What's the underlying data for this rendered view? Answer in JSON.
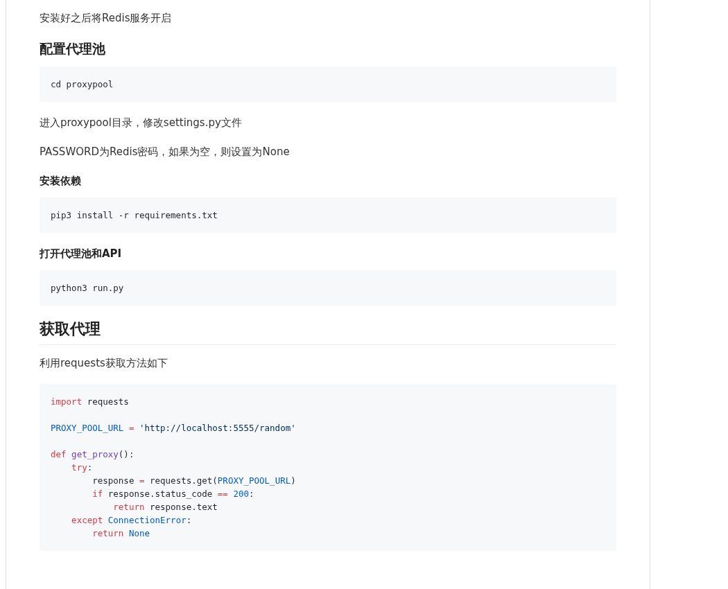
{
  "blocks": [
    {
      "kind": "paragraph",
      "text": "安装好之后将Redis服务开启"
    },
    {
      "kind": "heading_medium",
      "text": "配置代理池"
    },
    {
      "kind": "code",
      "lines": [
        {
          "tokens": [
            {
              "kind": "plain",
              "text": "cd proxypool"
            }
          ]
        }
      ]
    },
    {
      "kind": "paragraph",
      "text": "进入proxypool目录，修改settings.py文件"
    },
    {
      "kind": "paragraph",
      "text": "PASSWORD为Redis密码，如果为空，则设置为None"
    },
    {
      "kind": "heading_small",
      "text": "安装依赖"
    },
    {
      "kind": "code",
      "lines": [
        {
          "tokens": [
            {
              "kind": "plain",
              "text": "pip3 install -r requirements.txt"
            }
          ]
        }
      ]
    },
    {
      "kind": "heading_small",
      "text": "打开代理池和API"
    },
    {
      "kind": "code",
      "lines": [
        {
          "tokens": [
            {
              "kind": "plain",
              "text": "python3 run.py"
            }
          ]
        }
      ]
    },
    {
      "kind": "heading_large",
      "text": "获取代理"
    },
    {
      "kind": "paragraph",
      "text": "利用requests获取方法如下"
    },
    {
      "kind": "code",
      "lines": [
        {
          "tokens": [
            {
              "kind": "keyword",
              "text": "import"
            },
            {
              "kind": "plain",
              "text": " requests"
            }
          ]
        },
        {
          "space_before": true,
          "tokens": [
            {
              "kind": "name",
              "text": "PROXY_POOL_URL"
            },
            {
              "kind": "keyword",
              "text": " = "
            },
            {
              "kind": "string",
              "text": "'http://localhost:5555/random'"
            }
          ]
        },
        {
          "space_before": true,
          "tokens": [
            {
              "kind": "keyword",
              "text": "def "
            },
            {
              "kind": "function",
              "text": "get_proxy"
            },
            {
              "kind": "plain",
              "text": "():"
            }
          ]
        },
        {
          "tokens": [
            {
              "kind": "keyword",
              "text": "    try"
            },
            {
              "kind": "plain",
              "text": ":"
            }
          ]
        },
        {
          "tokens": [
            {
              "kind": "plain",
              "text": "        response"
            },
            {
              "kind": "keyword",
              "text": " = "
            },
            {
              "kind": "plain",
              "text": "requests.get("
            },
            {
              "kind": "name",
              "text": "PROXY_POOL_URL"
            },
            {
              "kind": "plain",
              "text": ")"
            }
          ]
        },
        {
          "tokens": [
            {
              "kind": "keyword",
              "text": "        if"
            },
            {
              "kind": "plain",
              "text": " response.status_code"
            },
            {
              "kind": "keyword",
              "text": " == "
            },
            {
              "kind": "name",
              "text": "200"
            },
            {
              "kind": "plain",
              "text": ":"
            }
          ]
        },
        {
          "tokens": [
            {
              "kind": "keyword",
              "text": "            return"
            },
            {
              "kind": "plain",
              "text": " response.text"
            }
          ]
        },
        {
          "tokens": [
            {
              "kind": "keyword",
              "text": "    except "
            },
            {
              "kind": "name",
              "text": "ConnectionError"
            },
            {
              "kind": "plain",
              "text": ":"
            }
          ]
        },
        {
          "tokens": [
            {
              "kind": "keyword",
              "text": "        return "
            },
            {
              "kind": "name",
              "text": "None"
            }
          ]
        }
      ]
    }
  ]
}
